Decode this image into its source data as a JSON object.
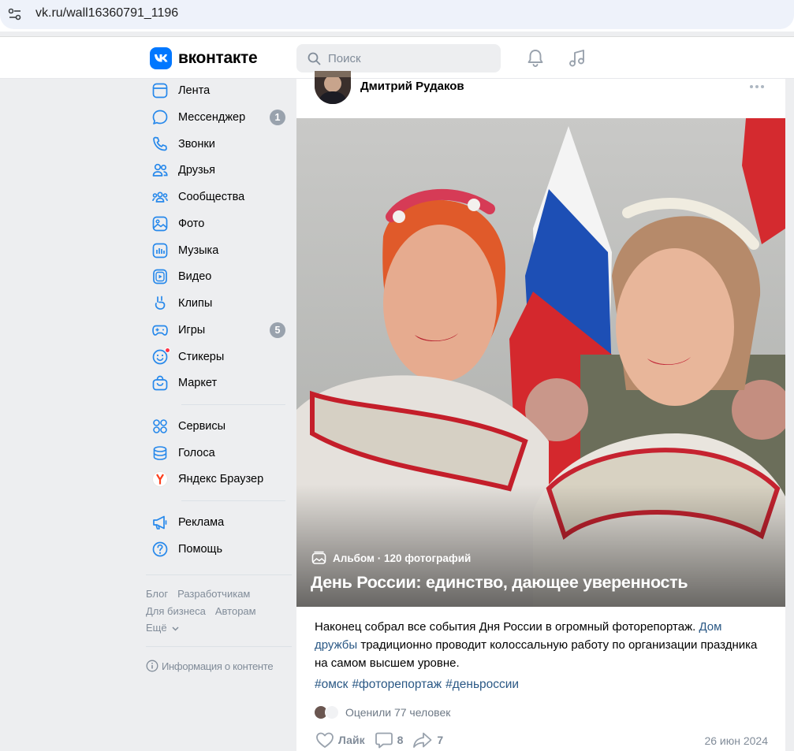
{
  "browser": {
    "url": "vk.ru/wall16360791_1196"
  },
  "header": {
    "logo_text": "вконтакте",
    "search_placeholder": "Поиск"
  },
  "sidebar": {
    "items": [
      {
        "label": "Лента",
        "icon": "feed-icon"
      },
      {
        "label": "Мессенджер",
        "icon": "messenger-icon",
        "badge": "1"
      },
      {
        "label": "Звонки",
        "icon": "phone-icon"
      },
      {
        "label": "Друзья",
        "icon": "friends-icon"
      },
      {
        "label": "Сообщества",
        "icon": "communities-icon"
      },
      {
        "label": "Фото",
        "icon": "photo-icon"
      },
      {
        "label": "Музыка",
        "icon": "music-icon"
      },
      {
        "label": "Видео",
        "icon": "video-icon"
      },
      {
        "label": "Клипы",
        "icon": "clips-icon"
      },
      {
        "label": "Игры",
        "icon": "games-icon",
        "badge": "5"
      },
      {
        "label": "Стикеры",
        "icon": "stickers-icon"
      },
      {
        "label": "Маркет",
        "icon": "market-icon"
      }
    ],
    "items2": [
      {
        "label": "Сервисы",
        "icon": "services-icon"
      },
      {
        "label": "Голоса",
        "icon": "voices-icon"
      },
      {
        "label": "Яндекс Браузер",
        "icon": "yandex-icon"
      }
    ],
    "items3": [
      {
        "label": "Реклама",
        "icon": "ads-icon"
      },
      {
        "label": "Помощь",
        "icon": "help-icon"
      }
    ],
    "footer": {
      "blog": "Блог",
      "developers": "Разработчикам",
      "business": "Для бизнеса",
      "authors": "Авторам",
      "more": "Ещё"
    },
    "info": "Информация о контенте"
  },
  "post": {
    "author": "Дмитрий Рудаков",
    "album_label": "Альбом · 120 фотографий",
    "album_title": "День России: единство, дающее уверенность",
    "text_before": "Наконец собрал все события Дня России в огромный фоторепортаж. ",
    "text_link": "Дом дружбы",
    "text_after": " традиционно проводит колоссальную работу по организации праздника на самом высшем уровне.",
    "tags": [
      "#омск",
      "#фоторепортаж",
      "#деньроссии"
    ],
    "likers_text": "Оценили 77 человек",
    "like_label": "Лайк",
    "comments_count": "8",
    "shares_count": "7",
    "date": "26 июн 2024"
  }
}
